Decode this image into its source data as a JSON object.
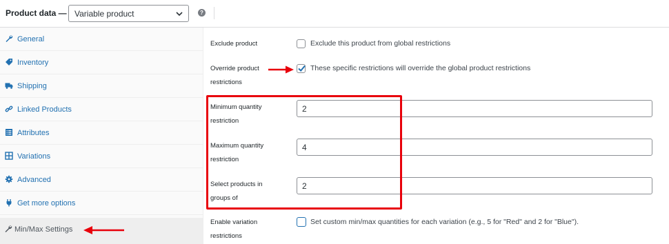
{
  "header": {
    "title": "Product data —",
    "product_type": "Variable product",
    "help_label": "?"
  },
  "sidebar": {
    "items": [
      {
        "label": "General",
        "icon": "wrench-icon"
      },
      {
        "label": "Inventory",
        "icon": "tag-icon"
      },
      {
        "label": "Shipping",
        "icon": "truck-icon"
      },
      {
        "label": "Linked Products",
        "icon": "link-icon"
      },
      {
        "label": "Attributes",
        "icon": "list-icon"
      },
      {
        "label": "Variations",
        "icon": "grid-icon"
      },
      {
        "label": "Advanced",
        "icon": "gear-icon"
      },
      {
        "label": "Get more options",
        "icon": "plugin-icon"
      },
      {
        "label": "Min/Max Settings",
        "icon": "wrench-icon",
        "active": true
      }
    ]
  },
  "main": {
    "exclude": {
      "label": "Exclude product",
      "checkbox_text": "Exclude this product from global restrictions",
      "checked": false
    },
    "override": {
      "label_line1": "Override product",
      "label_line2": "restrictions",
      "checkbox_text": "These specific restrictions will override the global product restrictions",
      "checked": true
    },
    "min_qty": {
      "label_line1": "Minimum quantity",
      "label_line2": "restriction",
      "value": "2"
    },
    "max_qty": {
      "label_line1": "Maximum quantity",
      "label_line2": "restriction",
      "value": "4"
    },
    "group_of": {
      "label_line1": "Select products in",
      "label_line2": "groups of",
      "value": "2"
    },
    "variation": {
      "label_line1": "Enable variation",
      "label_line2": "restrictions",
      "checkbox_text": "Set custom min/max quantities for each variation (e.g., 5 for \"Red\" and 2 for \"Blue\").",
      "checked": false
    }
  },
  "colors": {
    "annotation_red": "#e8000b",
    "link_blue": "#2271b1",
    "checkbox_blue": "#2271b1"
  }
}
